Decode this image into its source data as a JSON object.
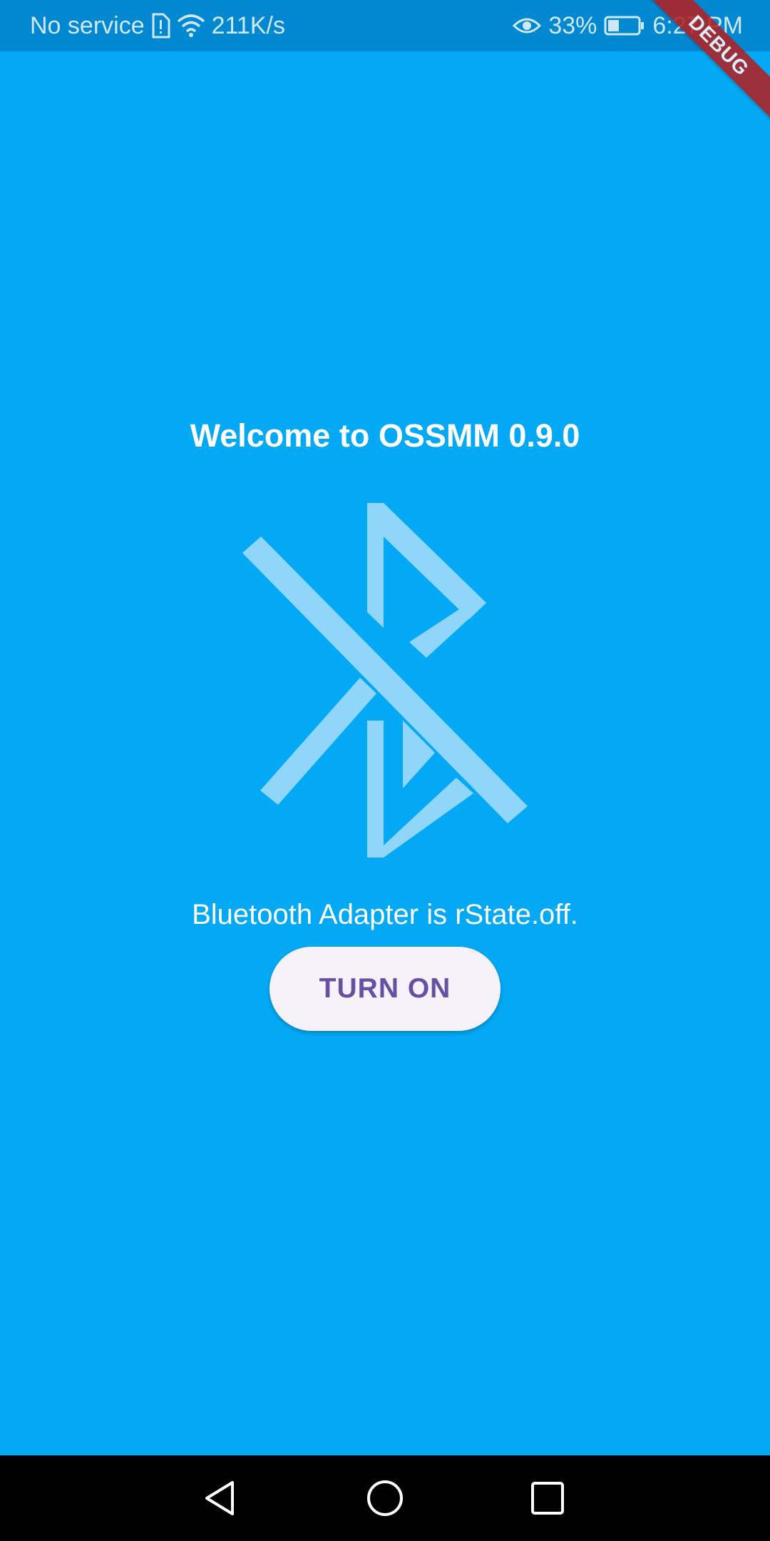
{
  "status_bar": {
    "carrier": "No service",
    "speed": "211K/s",
    "battery": "33%",
    "time": "6:27 PM",
    "icons": [
      "sim-alert-icon",
      "wifi-icon",
      "eye-icon",
      "battery-icon"
    ]
  },
  "debug_banner": "DEBUG",
  "main": {
    "title": "Welcome to OSSMM 0.9.0",
    "icon": "bluetooth-disabled-icon",
    "status": "Bluetooth Adapter is rState.off.",
    "button_label": "TURN ON"
  },
  "nav_bar": {
    "icons": [
      "back-icon",
      "home-icon",
      "recents-icon"
    ]
  },
  "colors": {
    "background": "#03A9F4",
    "status_bar": "#0288D1",
    "icon_tint": "#90D6FA",
    "button_bg": "#F7F2FA",
    "button_text": "#6750A4"
  }
}
